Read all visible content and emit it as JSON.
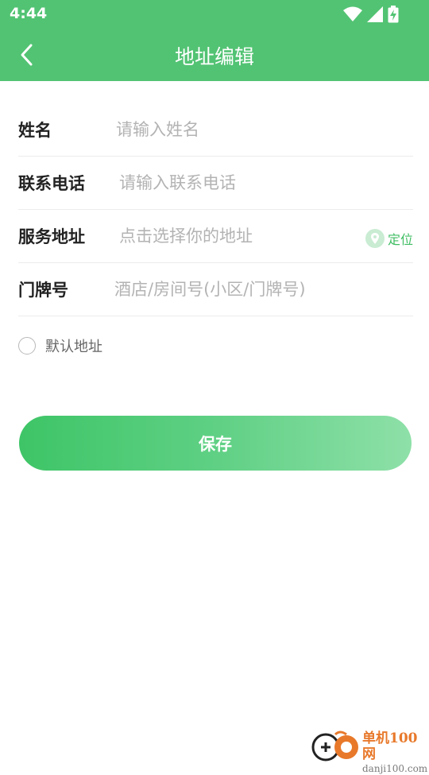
{
  "status_bar": {
    "time": "4:44"
  },
  "header": {
    "title": "地址编辑"
  },
  "form": {
    "name": {
      "label": "姓名",
      "placeholder": "请输入姓名",
      "value": ""
    },
    "phone": {
      "label": "联系电话",
      "placeholder": "请输入联系电话",
      "value": ""
    },
    "address": {
      "label": "服务地址",
      "placeholder": "点击选择你的地址",
      "value": "",
      "locate_label": "定位"
    },
    "door": {
      "label": "门牌号",
      "placeholder": "酒店/房间号(小区/门牌号)",
      "value": ""
    }
  },
  "default_address": {
    "label": "默认地址",
    "checked": false
  },
  "save_button": {
    "label": "保存"
  },
  "watermark": {
    "title": "单机100网",
    "url": "danji100.com"
  },
  "colors": {
    "primary": "#52c373",
    "accent": "#3fbd62",
    "gradient_start": "#3ec567",
    "gradient_end": "#8ee0a8"
  },
  "icons": {
    "back": "chevron-left-icon",
    "wifi": "wifi-icon",
    "signal": "signal-icon",
    "battery": "battery-charging-icon",
    "locate": "location-pin-icon",
    "radio": "radio-unchecked-icon"
  }
}
